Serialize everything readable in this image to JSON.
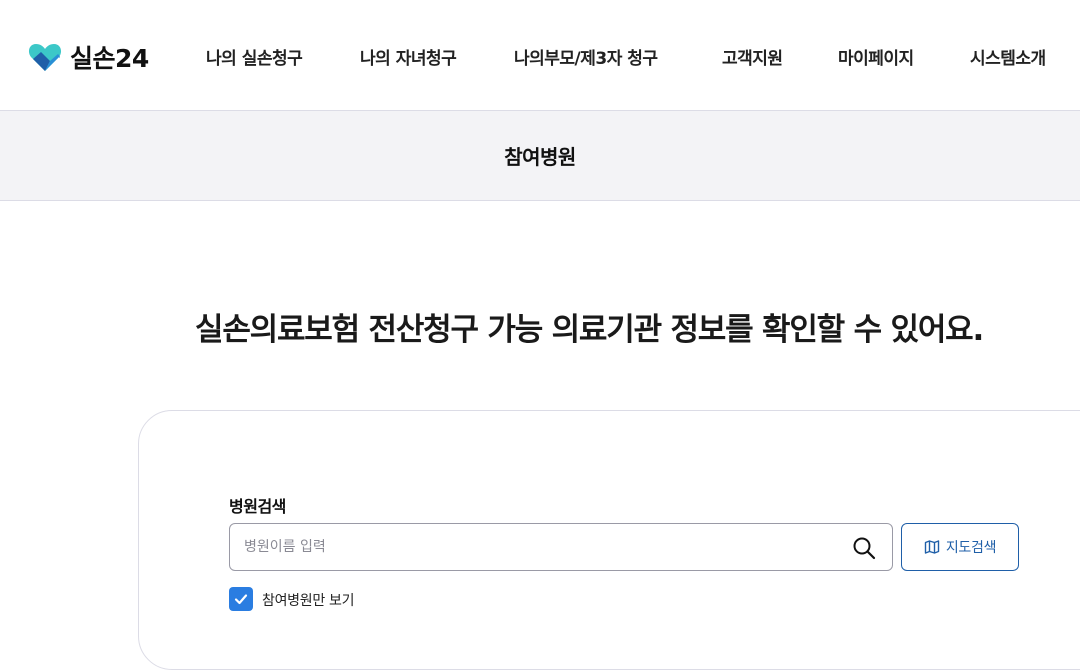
{
  "header": {
    "logo_text": "실손24",
    "nav": [
      {
        "label": "나의 실손청구"
      },
      {
        "label": "나의 자녀청구"
      },
      {
        "label": "나의부모/제3자 청구"
      },
      {
        "label": "고객지원"
      },
      {
        "label": "마이페이지"
      },
      {
        "label": "시스템소개"
      }
    ]
  },
  "subbar": {
    "title": "참여병원"
  },
  "main": {
    "headline": "실손의료보험 전산청구 가능 의료기관 정보를 확인할 수 있어요.",
    "search": {
      "label": "병원검색",
      "value": "",
      "placeholder": "병원이름 입력"
    },
    "map_button": {
      "label": "지도검색",
      "icon": "map-icon"
    },
    "participating_only": {
      "label": "참여병원만 보기",
      "checked": true
    }
  },
  "colors": {
    "accent": "#1f5fa8",
    "checkbox": "#2a7de1",
    "subbar_bg": "#f3f3f6",
    "logo_teal": "#3cc8c8",
    "logo_blue": "#1f5fa8"
  }
}
